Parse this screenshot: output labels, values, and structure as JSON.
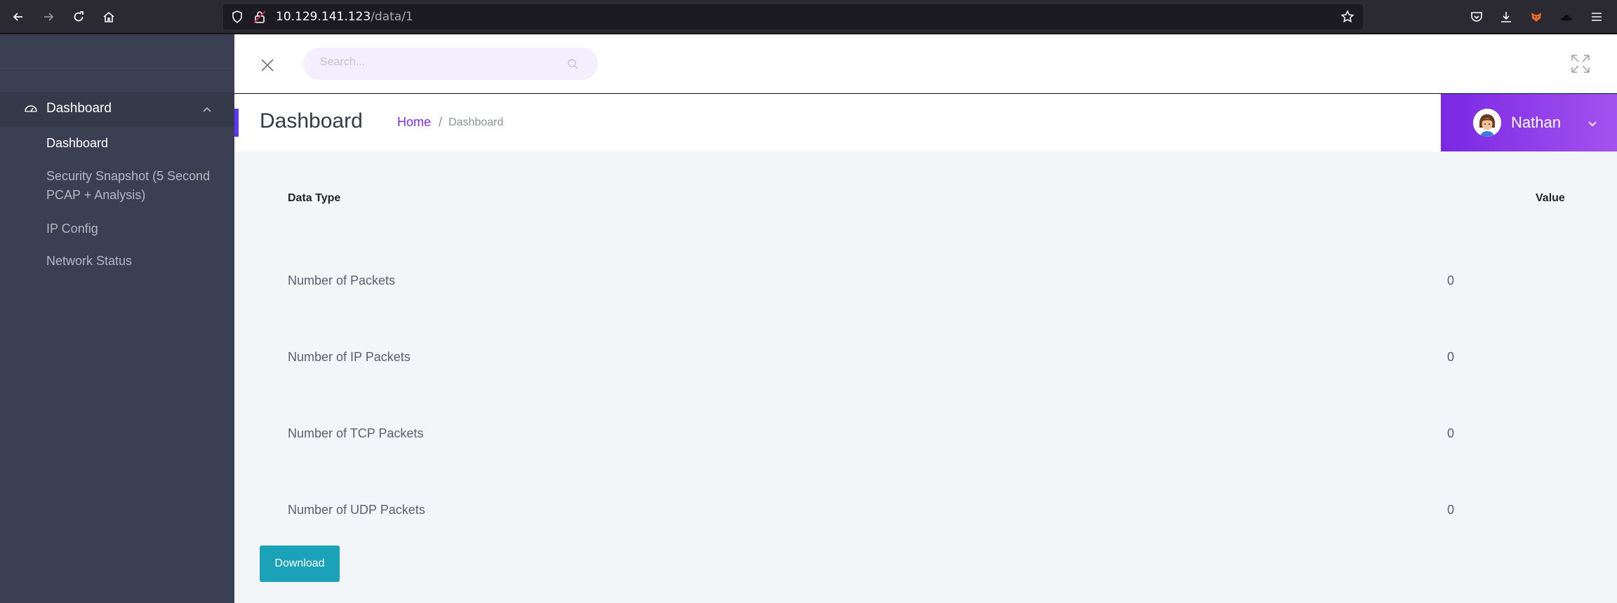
{
  "browser": {
    "url_host": "10.129.141.123",
    "url_path": "/data/1"
  },
  "sidebar": {
    "group_label": "Dashboard",
    "items": [
      {
        "label": "Dashboard",
        "active": true
      },
      {
        "label": "Security Snapshot (5 Second PCAP + Analysis)",
        "active": false
      },
      {
        "label": "IP Config",
        "active": false
      },
      {
        "label": "Network Status",
        "active": false
      }
    ]
  },
  "topbar": {
    "search_placeholder": "Search..."
  },
  "header": {
    "title": "Dashboard",
    "breadcrumb_home": "Home",
    "breadcrumb_separator": "/",
    "breadcrumb_current": "Dashboard"
  },
  "user": {
    "name": "Nathan"
  },
  "table": {
    "columns": [
      "Data Type",
      "Value"
    ],
    "rows": [
      {
        "label": "Number of Packets",
        "value": "0"
      },
      {
        "label": "Number of IP Packets",
        "value": "0"
      },
      {
        "label": "Number of TCP Packets",
        "value": "0"
      },
      {
        "label": "Number of UDP Packets",
        "value": "0"
      }
    ]
  },
  "actions": {
    "download_label": "Download"
  },
  "colors": {
    "sidebar_bg": "#3a3f51",
    "accent_purple": "#7a28e3",
    "download_teal": "#1ba2b8",
    "content_bg": "#f2f6f8"
  }
}
